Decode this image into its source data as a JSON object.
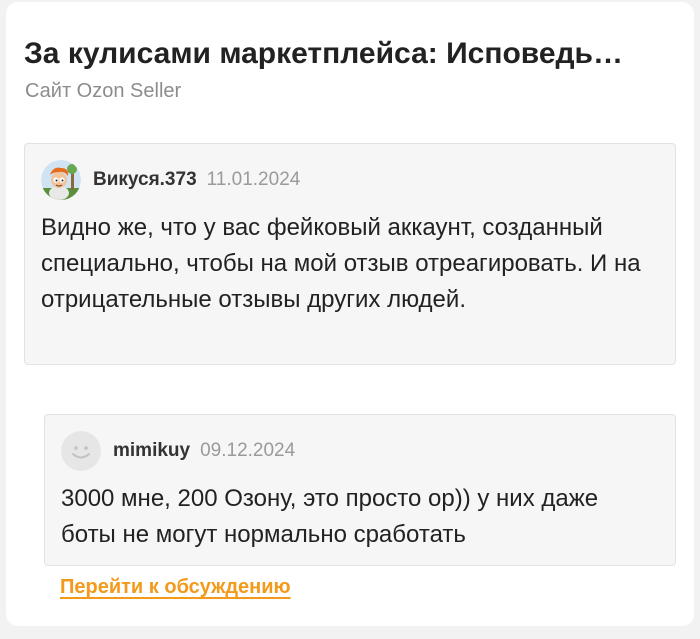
{
  "post": {
    "title": "За кулисами маркетплейса: Исповедь…",
    "source": "Сайт Ozon Seller"
  },
  "comments": [
    {
      "author": "Викуся.373",
      "date": "11.01.2024",
      "avatar_icon": "cartoon-character-avatar",
      "text": "Видно же, что у вас фейковый аккаунт, созданный специально, чтобы на мой отзыв отреагировать. И на отрицательные отзывы других людей."
    },
    {
      "author": "mimikuy",
      "date": "09.12.2024",
      "avatar_icon": "smiley-face-avatar",
      "text": "3000 мне, 200 Озону, это просто ор)) у них даже боты не могут нормально сработать"
    }
  ],
  "footer": {
    "discuss_link": "Перейти к обсуждению"
  },
  "colors": {
    "accent": "#f39a1b",
    "comment_bg": "#f6f6f6",
    "muted_text": "#9a9a9a"
  }
}
